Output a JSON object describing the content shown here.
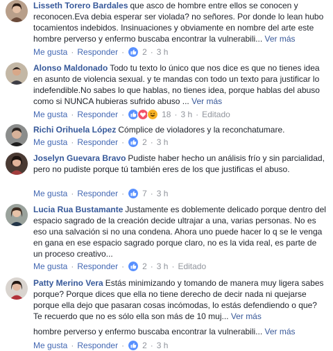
{
  "comments": [
    {
      "author": "Lisseth Torero Bardales",
      "text": "que asco de hombre entre ellos se conocen y reconocen.Eva debia esperar ser violada? no señores. Por donde lo lean hubo tocamientos indebidos. Insinuaciones y obviamente en nombre del arte este hombre perverso y enfermo buscaba encontrar la vulnerabili...",
      "more": "Ver más",
      "like": "Me gusta",
      "reply": "Responder",
      "reactions": "2",
      "time": "3 h",
      "edited": ""
    },
    {
      "author": "Alonso Maldonado",
      "text": "Todo tu texto lo único que nos dice es que no tienes idea en asunto de violencia sexual. y te mandas con todo un texto para justificar lo indefendible.No sabes lo que hablas, no tienes idea, porque hablas del abuso como si NUNCA hubieras sufrido abuso ...",
      "more": "Ver más",
      "like": "Me gusta",
      "reply": "Responder",
      "reactions": "18",
      "time": "3 h",
      "edited": "Editado"
    },
    {
      "author": "Richi Orihuela López",
      "text": "Cómplice de violadores y la reconchatumare.",
      "more": "",
      "like": "Me gusta",
      "reply": "Responder",
      "reactions": "2",
      "time": "3 h",
      "edited": ""
    },
    {
      "author": "Joselyn Guevara Bravo",
      "text": "Pudiste haber hecho un análisis frío y sin parcialidad, pero no pudiste porque tú también eres de los que justificas el abuso.",
      "more": "",
      "like": "Me gusta",
      "reply": "Responder",
      "reactions": "7",
      "time": "3 h",
      "edited": ""
    },
    {
      "author": "Lucia Rua Bustamante",
      "text": "Justamente es doblemente delicado porque dentro del espacio sagrado de la creación decide ultrajar a una, varias personas. No es eso una salvación si no una condena. Ahora uno puede hacer lo q se le venga en gana en ese espacio sagrado porque claro, no es la vida real, es parte de un proceso creativo...",
      "more": "",
      "like": "Me gusta",
      "reply": "Responder",
      "reactions": "2",
      "time": "3 h",
      "edited": "Editado"
    },
    {
      "author": "Patty Merino Vera",
      "text": "Estás minimizando y tomando de manera muy ligera sabes porque? Porque dices que ella no tiene derecho de decir nada ni quejarse porque ella dejo que pasaran cosas incómodas, lo estás defendiendo o que? Te recuerdo que no es sólo ella son más de 10 muj...",
      "more": "Ver más",
      "like": "",
      "reply": "",
      "reactions": "",
      "time": "",
      "edited": ""
    }
  ],
  "partial": {
    "text": "hombre perverso y enfermo buscaba encontrar la vulnerabili...",
    "more": "Ver más",
    "like": "Me gusta",
    "reply": "Responder",
    "reactions": "2",
    "time": "3 h"
  },
  "colors": {
    "author": "#365899",
    "link": "#4267b2",
    "meta": "#90949c",
    "like_blue": "#5890ff",
    "love_red": "#f25268",
    "haha_yellow": "#f7b125"
  },
  "icons": {
    "like": "like-reaction-icon",
    "love": "love-reaction-icon",
    "haha": "haha-reaction-icon"
  }
}
